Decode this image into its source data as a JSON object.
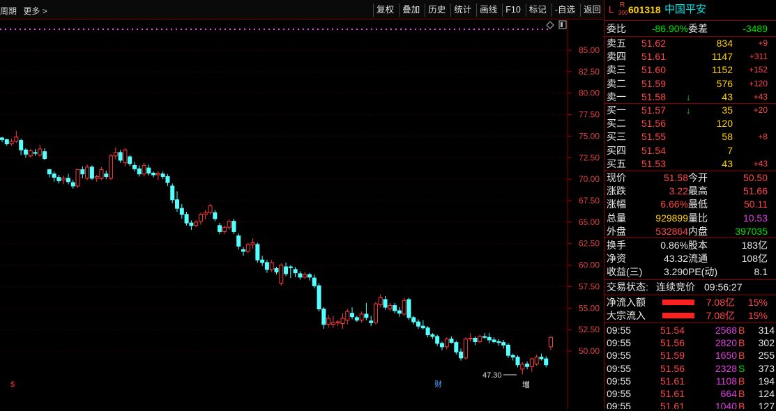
{
  "topbar": {
    "left_items": [
      "周期",
      "更多 >"
    ],
    "toolbar": [
      "复权",
      "叠加",
      "历史",
      "统计",
      "画线",
      "F10",
      "标记",
      "-自选",
      "返回"
    ]
  },
  "stock": {
    "code": "601318",
    "name": "中国平安",
    "l_mark": "L",
    "r_mark": "R",
    "r_sub": "300"
  },
  "commit": {
    "ratio_label": "委比",
    "ratio": "-86.90%",
    "diff_label": "委差",
    "diff": "-3489"
  },
  "asks": [
    {
      "label": "卖五",
      "price": "51.62",
      "vol": "834",
      "chg": "+9",
      "arrow": ""
    },
    {
      "label": "卖四",
      "price": "51.61",
      "vol": "1147",
      "chg": "+311",
      "arrow": ""
    },
    {
      "label": "卖三",
      "price": "51.60",
      "vol": "1152",
      "chg": "+152",
      "arrow": ""
    },
    {
      "label": "卖二",
      "price": "51.59",
      "vol": "576",
      "chg": "+120",
      "arrow": ""
    },
    {
      "label": "卖一",
      "price": "51.58",
      "vol": "43",
      "chg": "+43",
      "arrow": "↓"
    }
  ],
  "bids": [
    {
      "label": "买一",
      "price": "51.57",
      "vol": "35",
      "chg": "+20",
      "arrow": "↓"
    },
    {
      "label": "买二",
      "price": "51.56",
      "vol": "120",
      "chg": "",
      "arrow": ""
    },
    {
      "label": "买三",
      "price": "51.55",
      "vol": "58",
      "chg": "+8",
      "arrow": ""
    },
    {
      "label": "买四",
      "price": "51.54",
      "vol": "7",
      "chg": "",
      "arrow": ""
    },
    {
      "label": "买五",
      "price": "51.53",
      "vol": "43",
      "chg": "+43",
      "arrow": ""
    }
  ],
  "quote": [
    {
      "l1": "现价",
      "v1": "51.58",
      "c1": "red",
      "l2": "今开",
      "v2": "50.50",
      "c2": "red"
    },
    {
      "l1": "涨跌",
      "v1": "3.22",
      "c1": "red",
      "l2": "最高",
      "v2": "51.66",
      "c2": "red"
    },
    {
      "l1": "涨幅",
      "v1": "6.66%",
      "c1": "red",
      "l2": "最低",
      "v2": "50.11",
      "c2": "red"
    },
    {
      "l1": "总量",
      "v1": "929899",
      "c1": "yel",
      "l2": "量比",
      "v2": "10.53",
      "c2": "mag"
    },
    {
      "l1": "外盘",
      "v1": "532864",
      "c1": "red",
      "l2": "内盘",
      "v2": "397035",
      "c2": "grn"
    }
  ],
  "fund": [
    {
      "l1": "换手",
      "v1": "0.86%",
      "l2": "股本",
      "v2": "183亿"
    },
    {
      "l1": "净资",
      "v1": "43.32",
      "l2": "流通",
      "v2": "108亿"
    },
    {
      "l1": "收益(三)",
      "v1": "3.290",
      "l2": "PE(动)",
      "v2": "8.1"
    }
  ],
  "status": {
    "label": "交易状态:",
    "value": "连续竞价",
    "time": "09:56:27"
  },
  "flows": [
    {
      "label": "净流入额",
      "amount": "7.08亿",
      "pct": "15%"
    },
    {
      "label": "大宗流入",
      "amount": "7.08亿",
      "pct": "15%"
    }
  ],
  "ticks": [
    {
      "time": "09:55",
      "price": "51.54",
      "vol": "2568",
      "bs": "B",
      "n": "314"
    },
    {
      "time": "09:55",
      "price": "51.56",
      "vol": "2820",
      "bs": "B",
      "n": "302"
    },
    {
      "time": "09:55",
      "price": "51.59",
      "vol": "1650",
      "bs": "B",
      "n": "255"
    },
    {
      "time": "09:55",
      "price": "51.56",
      "vol": "2328",
      "bs": "S",
      "n": "373"
    },
    {
      "time": "09:55",
      "price": "51.61",
      "vol": "1108",
      "bs": "B",
      "n": "194"
    },
    {
      "time": "09:55",
      "price": "51.61",
      "vol": "664",
      "bs": "B",
      "n": "124"
    },
    {
      "time": "09:55",
      "price": "51.61",
      "vol": "1040",
      "bs": "B",
      "n": "127"
    }
  ],
  "chart_data": {
    "type": "candlestick",
    "y_ticks": [
      "85.00",
      "82.50",
      "80.00",
      "77.50",
      "75.00",
      "72.50",
      "70.00",
      "67.50",
      "65.00",
      "62.50",
      "60.00",
      "57.50",
      "55.00",
      "52.50",
      "50.00"
    ],
    "ylim": [
      46.5,
      87.5
    ],
    "annotation_low": "47.30",
    "markers": [
      "$",
      "财",
      "增"
    ],
    "candles": [
      [
        74.8,
        74.9,
        74.3,
        74.6
      ],
      [
        74.6,
        74.7,
        73.9,
        74.1
      ],
      [
        74.1,
        74.7,
        73.9,
        74.4
      ],
      [
        74.4,
        75.6,
        74.2,
        74.9
      ],
      [
        74.5,
        74.7,
        72.8,
        73.4
      ],
      [
        73.4,
        73.6,
        72.5,
        72.9
      ],
      [
        72.7,
        73.5,
        72.5,
        73.3
      ],
      [
        73.1,
        73.5,
        72.7,
        73.0
      ],
      [
        72.8,
        74.0,
        72.6,
        73.5
      ],
      [
        73.2,
        73.6,
        72.2,
        72.4
      ],
      [
        71.1,
        71.2,
        70.2,
        70.6
      ],
      [
        70.6,
        70.9,
        69.7,
        70.2
      ],
      [
        70.2,
        70.5,
        69.5,
        69.8
      ],
      [
        69.9,
        70.4,
        69.4,
        70.1
      ],
      [
        70.1,
        70.6,
        69.4,
        69.7
      ],
      [
        69.6,
        69.9,
        68.9,
        69.2
      ],
      [
        69.2,
        71.2,
        69.0,
        71.1
      ],
      [
        71.1,
        71.5,
        70.1,
        70.6
      ],
      [
        70.1,
        71.7,
        69.9,
        71.4
      ],
      [
        71.4,
        71.6,
        69.9,
        70.1
      ],
      [
        70.1,
        70.5,
        69.7,
        70.3
      ],
      [
        70.1,
        71.4,
        69.9,
        71.1
      ],
      [
        70.6,
        71.0,
        70.0,
        70.3
      ],
      [
        70.1,
        72.9,
        69.9,
        72.7
      ],
      [
        72.7,
        73.7,
        72.3,
        73.1
      ],
      [
        73.1,
        73.4,
        71.9,
        72.2
      ],
      [
        71.9,
        73.6,
        71.5,
        73.4
      ],
      [
        72.6,
        72.8,
        71.5,
        71.8
      ],
      [
        71.6,
        72.0,
        70.9,
        71.2
      ],
      [
        71.2,
        71.6,
        70.3,
        70.6
      ],
      [
        70.6,
        71.9,
        70.3,
        71.6
      ],
      [
        71.3,
        71.7,
        70.4,
        70.7
      ],
      [
        70.7,
        70.9,
        70.2,
        70.5
      ],
      [
        70.5,
        70.9,
        69.9,
        70.7
      ],
      [
        70.6,
        70.9,
        70.0,
        70.3
      ],
      [
        70.3,
        70.6,
        69.2,
        69.6
      ],
      [
        69.2,
        69.5,
        67.2,
        67.6
      ],
      [
        67.6,
        68.6,
        66.2,
        66.6
      ],
      [
        66.6,
        67.1,
        65.4,
        65.9
      ],
      [
        65.9,
        66.2,
        64.6,
        64.9
      ],
      [
        64.9,
        65.2,
        64.1,
        64.6
      ],
      [
        64.6,
        65.2,
        64.4,
        65.0
      ],
      [
        65.1,
        66.1,
        64.7,
        65.9
      ],
      [
        65.9,
        66.4,
        65.3,
        66.1
      ],
      [
        66.1,
        67.1,
        65.9,
        66.9
      ],
      [
        66.1,
        66.4,
        65.1,
        65.4
      ],
      [
        64.6,
        64.9,
        63.6,
        63.9
      ],
      [
        63.9,
        64.6,
        63.6,
        64.4
      ],
      [
        64.4,
        65.3,
        64.1,
        65.1
      ],
      [
        65.1,
        65.4,
        63.6,
        63.9
      ],
      [
        63.4,
        63.7,
        61.8,
        62.2
      ],
      [
        61.8,
        62.1,
        61.1,
        61.6
      ],
      [
        61.6,
        62.6,
        61.4,
        62.4
      ],
      [
        62.4,
        63.1,
        61.9,
        62.6
      ],
      [
        62.4,
        62.6,
        60.3,
        60.6
      ],
      [
        60.6,
        61.1,
        59.9,
        60.3
      ],
      [
        60.3,
        60.6,
        59.1,
        59.5
      ],
      [
        59.5,
        60.6,
        59.2,
        60.3
      ],
      [
        59.6,
        59.8,
        58.9,
        59.2
      ],
      [
        57.9,
        60.2,
        57.6,
        60.0
      ],
      [
        59.8,
        60.3,
        58.7,
        59.0
      ],
      [
        59.8,
        60.0,
        58.5,
        59.7
      ],
      [
        59.5,
        59.8,
        58.6,
        59.1
      ],
      [
        59.0,
        59.3,
        58.3,
        58.6
      ],
      [
        58.6,
        59.2,
        58.4,
        58.9
      ],
      [
        58.9,
        59.1,
        58.2,
        58.6
      ],
      [
        58.5,
        58.9,
        57.3,
        57.6
      ],
      [
        57.6,
        57.9,
        54.6,
        54.9
      ],
      [
        54.9,
        55.1,
        52.6,
        53.1
      ],
      [
        53.1,
        54.2,
        52.7,
        53.8
      ],
      [
        53.1,
        54.1,
        52.7,
        53.3
      ],
      [
        53.3,
        53.6,
        52.9,
        53.4
      ],
      [
        53.2,
        54.4,
        52.6,
        53.8
      ],
      [
        53.6,
        54.9,
        53.1,
        54.6
      ],
      [
        54.4,
        55.1,
        53.7,
        54.0
      ],
      [
        53.9,
        54.1,
        53.4,
        53.6
      ],
      [
        53.6,
        54.6,
        53.3,
        54.3
      ],
      [
        54.3,
        55.6,
        53.6,
        53.9
      ],
      [
        53.5,
        54.1,
        52.9,
        53.3
      ],
      [
        53.3,
        55.7,
        53.1,
        55.5
      ],
      [
        55.4,
        56.6,
        55.1,
        56.2
      ],
      [
        56.0,
        56.4,
        54.8,
        55.1
      ],
      [
        54.9,
        55.6,
        54.6,
        55.3
      ],
      [
        55.3,
        55.6,
        54.4,
        54.7
      ],
      [
        54.7,
        55.1,
        54.0,
        54.4
      ],
      [
        54.3,
        56.2,
        54.1,
        55.9
      ],
      [
        56.0,
        56.2,
        53.6,
        53.9
      ],
      [
        53.9,
        54.1,
        53.1,
        53.4
      ],
      [
        53.4,
        53.7,
        52.6,
        52.9
      ],
      [
        52.9,
        53.6,
        52.5,
        52.7
      ],
      [
        52.7,
        52.9,
        51.6,
        51.9
      ],
      [
        51.9,
        52.1,
        51.4,
        51.7
      ],
      [
        51.7,
        51.9,
        50.6,
        50.9
      ],
      [
        50.9,
        51.1,
        50.1,
        50.5
      ],
      [
        50.5,
        51.6,
        50.2,
        51.4
      ],
      [
        51.4,
        51.7,
        50.9,
        51.0
      ],
      [
        51.0,
        51.2,
        49.6,
        49.9
      ],
      [
        49.9,
        50.3,
        48.9,
        49.2
      ],
      [
        49.2,
        51.6,
        49.0,
        51.4
      ],
      [
        51.4,
        52.1,
        51.1,
        51.5
      ],
      [
        51.5,
        51.7,
        50.7,
        51.1
      ],
      [
        51.1,
        51.9,
        50.9,
        51.7
      ],
      [
        51.7,
        52.1,
        51.4,
        51.6
      ],
      [
        51.6,
        52.1,
        50.9,
        51.3
      ],
      [
        51.3,
        51.6,
        50.9,
        51.1
      ],
      [
        51.1,
        51.4,
        50.6,
        51.0
      ],
      [
        51.0,
        51.3,
        50.3,
        50.7
      ],
      [
        50.7,
        50.9,
        49.2,
        49.5
      ],
      [
        49.5,
        49.7,
        48.9,
        49.3
      ],
      [
        49.3,
        49.5,
        48.1,
        48.4
      ],
      [
        47.9,
        48.7,
        47.3,
        48.5
      ],
      [
        48.5,
        48.8,
        47.9,
        48.2
      ],
      [
        48.2,
        49.2,
        47.6,
        49.1
      ],
      [
        48.5,
        49.6,
        48.3,
        49.3
      ],
      [
        49.3,
        49.7,
        48.9,
        49.1
      ],
      [
        49.1,
        49.4,
        48.1,
        48.4
      ],
      [
        50.5,
        51.7,
        50.1,
        51.6
      ]
    ]
  }
}
